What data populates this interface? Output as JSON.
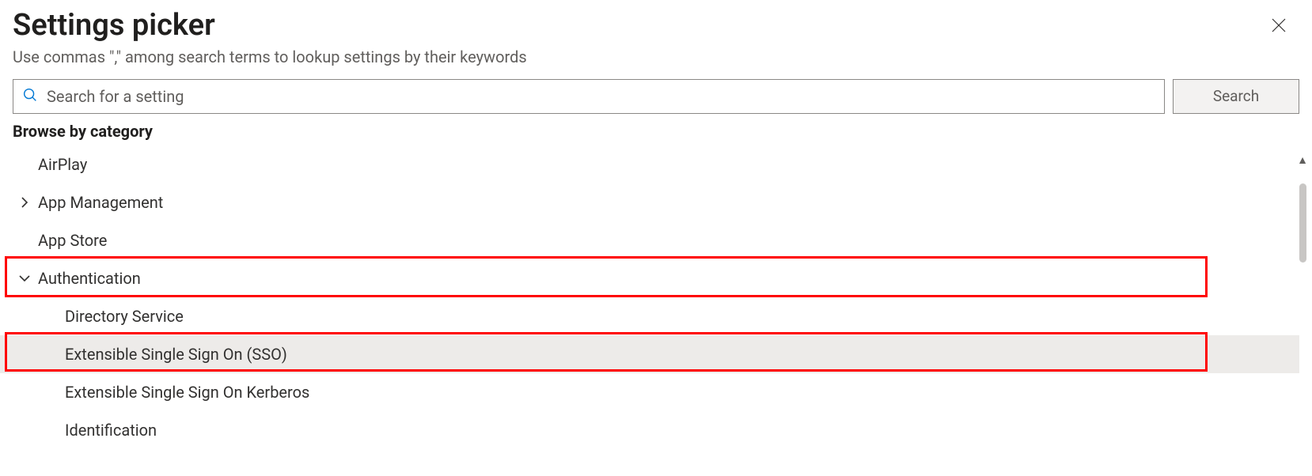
{
  "header": {
    "title": "Settings picker",
    "subtitle": "Use commas \",\" among search terms to lookup settings by their keywords"
  },
  "search": {
    "placeholder": "Search for a setting",
    "value": "",
    "button_label": "Search"
  },
  "browse": {
    "label": "Browse by category"
  },
  "categories": {
    "airplay": {
      "label": "AirPlay"
    },
    "app_management": {
      "label": "App Management"
    },
    "app_store": {
      "label": "App Store"
    },
    "authentication": {
      "label": "Authentication",
      "children": {
        "directory_service": {
          "label": "Directory Service"
        },
        "esso": {
          "label": "Extensible Single Sign On (SSO)"
        },
        "esso_kerberos": {
          "label": "Extensible Single Sign On Kerberos"
        },
        "identification": {
          "label": "Identification"
        }
      }
    }
  }
}
